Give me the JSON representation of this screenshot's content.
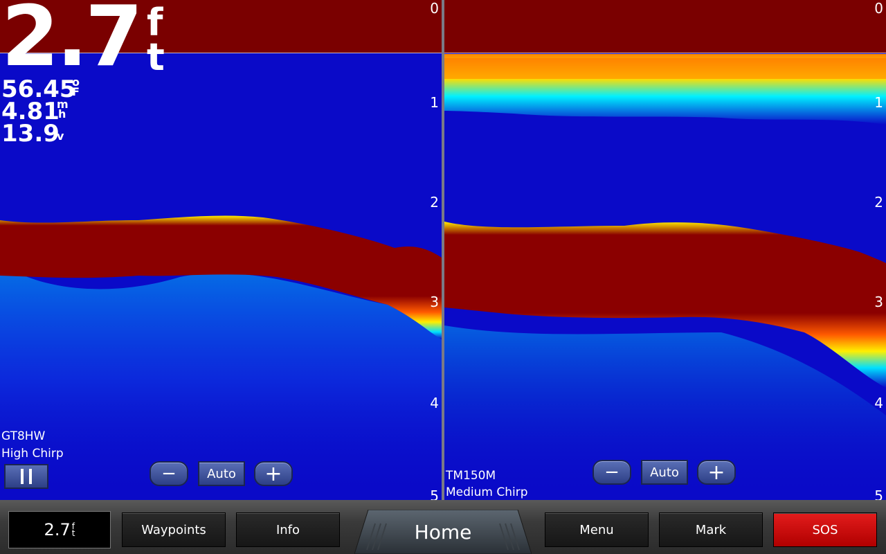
{
  "readouts": {
    "depth_value": "2.7",
    "depth_unit_top": "f",
    "depth_unit_bottom": "t",
    "water_temp": "56.45",
    "water_temp_unit_top": "o",
    "water_temp_unit_bottom": "F",
    "speed": "4.81",
    "speed_unit_top": "m",
    "speed_unit_bottom": "h",
    "voltage": "13.9",
    "voltage_unit": "v"
  },
  "depth_scale": [
    "0",
    "1",
    "2",
    "3",
    "4",
    "5"
  ],
  "left_panel": {
    "transducer": "GT8HW",
    "frequency": "High Chirp",
    "zoom_minus": "−",
    "zoom_auto": "Auto",
    "zoom_plus": "+"
  },
  "right_panel": {
    "transducer": "TM150M",
    "frequency": "Medium Chirp",
    "zoom_minus": "−",
    "zoom_auto": "Auto",
    "zoom_plus": "+"
  },
  "bottom_bar": {
    "depth_value": "2.7",
    "depth_unit_top": "f",
    "depth_unit_bottom": "t",
    "waypoints": "Waypoints",
    "info": "Info",
    "home": "Home",
    "menu": "Menu",
    "mark": "Mark",
    "sos": "SOS"
  },
  "colors": {
    "water": "#0a0ac8",
    "surface": "#7a0000",
    "bottom": "#8b0000",
    "sos": "#d40000"
  }
}
